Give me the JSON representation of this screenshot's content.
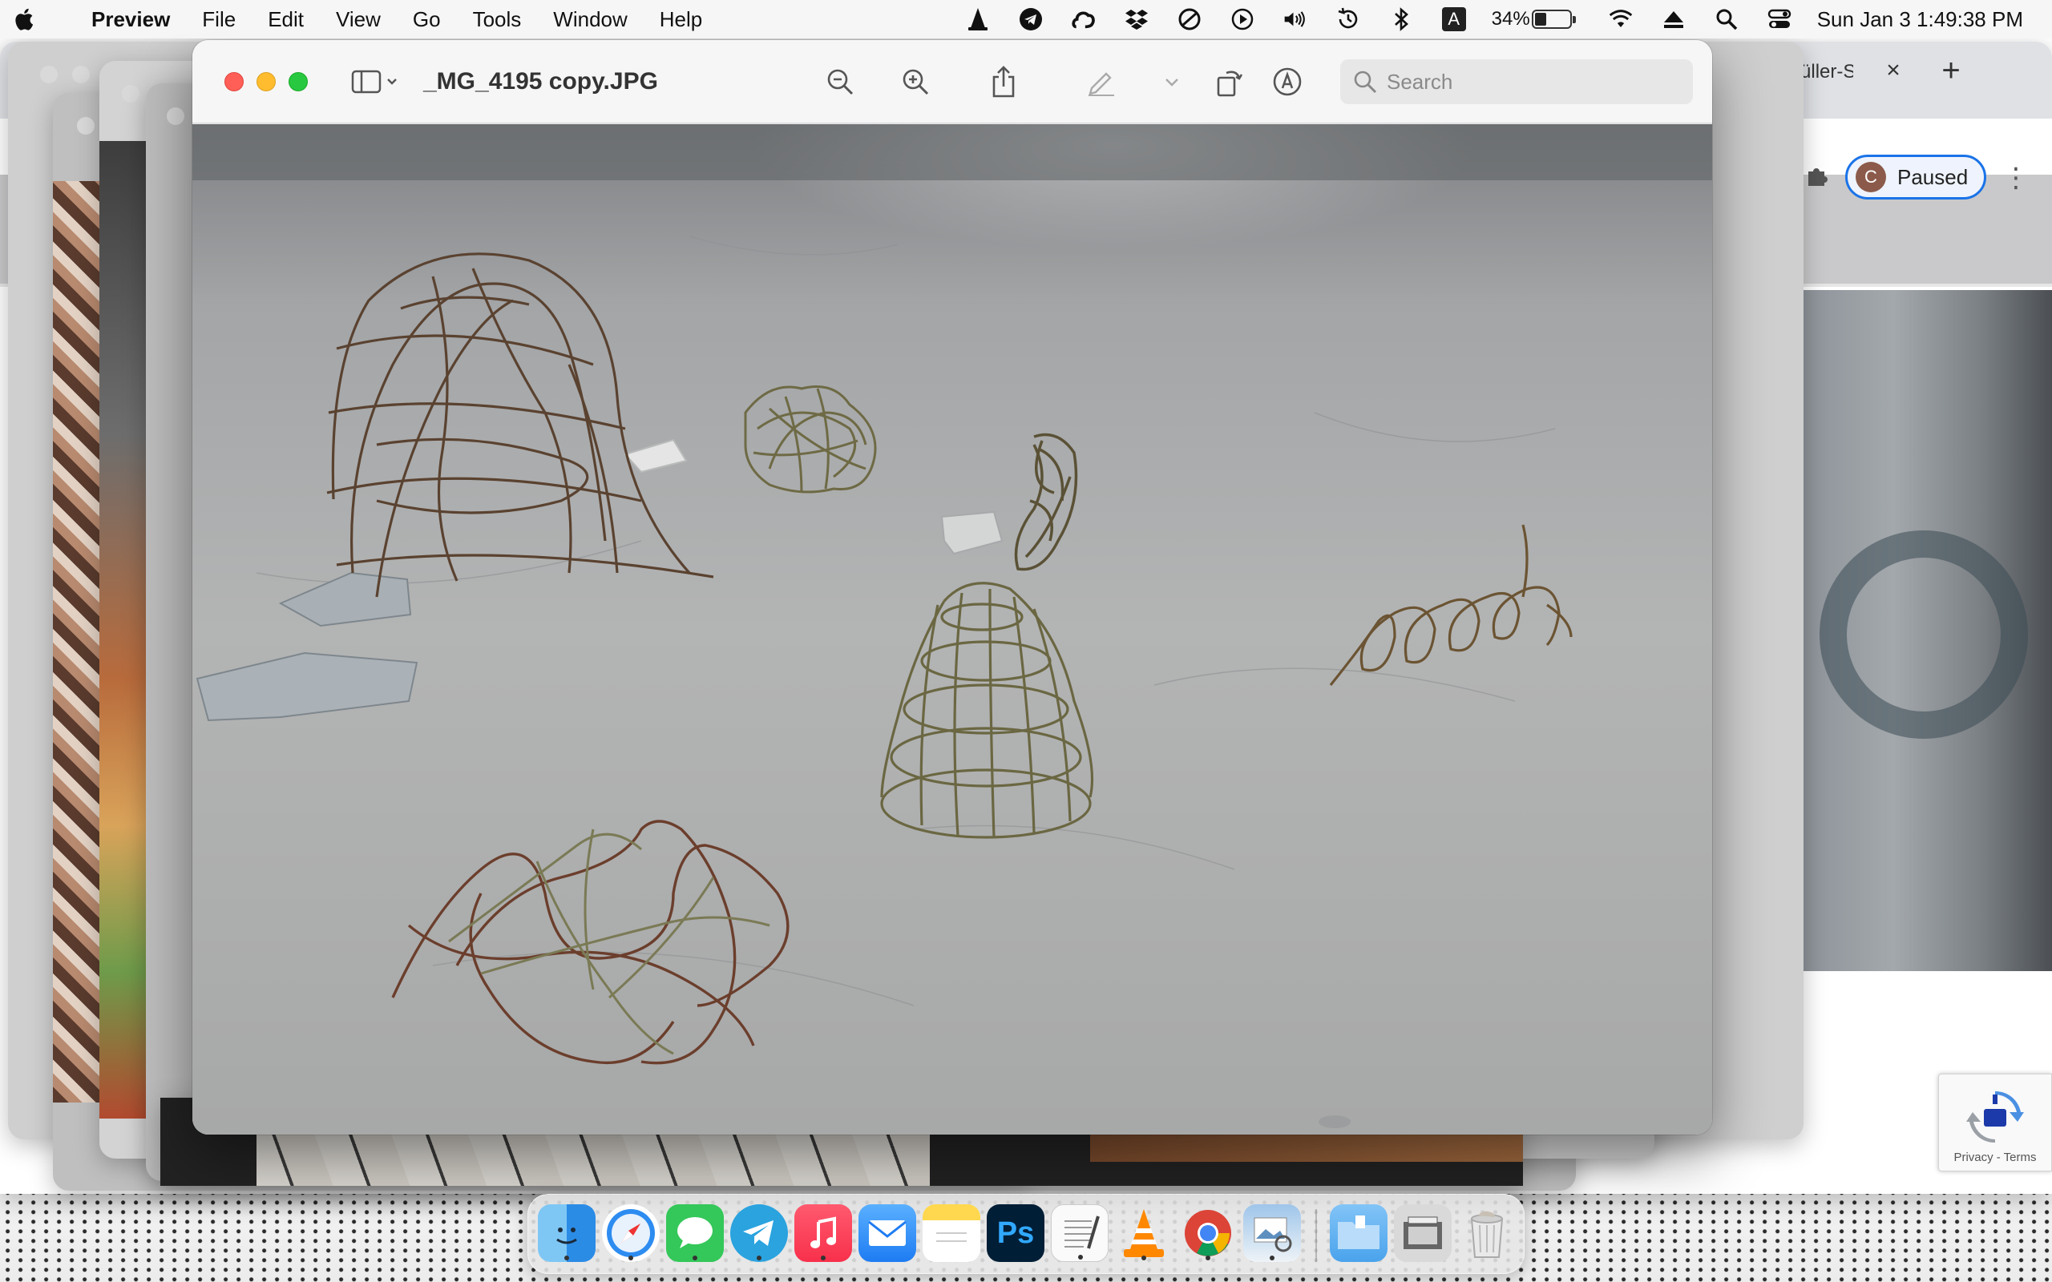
{
  "menubar": {
    "app_name": "Preview",
    "menus": [
      "File",
      "Edit",
      "View",
      "Go",
      "Tools",
      "Window",
      "Help"
    ],
    "battery_percent": "34%",
    "battery_level": 0.34,
    "input_source": "A",
    "clock": "Sun Jan 3  1:49:38 PM",
    "status_icons": [
      "vlc-icon",
      "telegram-icon",
      "creative-cloud-icon",
      "dropbox-icon",
      "do-not-disturb-icon",
      "play-icon",
      "volume-icon",
      "time-machine-icon",
      "bluetooth-icon",
      "input-source-icon",
      "battery-icon",
      "wifi-icon",
      "eject-icon",
      "spotlight-icon",
      "control-center-icon"
    ]
  },
  "preview": {
    "document_title": "_MG_4195 copy.JPG",
    "search_placeholder": "Search",
    "toolbar_icons": [
      "sidebar-icon",
      "zoom-out-icon",
      "zoom-in-icon",
      "share-icon",
      "markup-pen-icon",
      "rotate-icon",
      "markup-toolbar-icon"
    ]
  },
  "browser": {
    "tab_title": "Gustav-Müller-S",
    "profile_initial": "C",
    "profile_status": "Paused",
    "recaptcha_links": "Privacy - Terms"
  },
  "dock": {
    "apps": [
      "Finder",
      "Safari",
      "Messages",
      "Telegram",
      "Music",
      "Mail",
      "Notes",
      "Photoshop",
      "TextEdit",
      "VLC",
      "Chrome",
      "Preview",
      "Downloads",
      "Screenshot",
      "Trash"
    ],
    "photoshop_label": "Ps"
  },
  "colors": {
    "accent_blue": "#1a73e8",
    "close_red": "#ff5f57",
    "minimize_yellow": "#febc2e",
    "zoom_green": "#28c840"
  }
}
